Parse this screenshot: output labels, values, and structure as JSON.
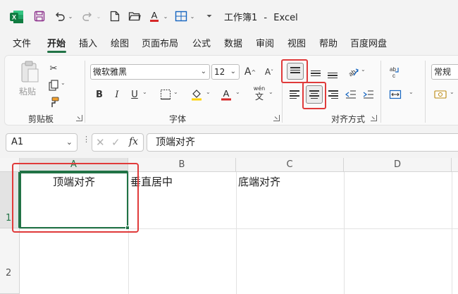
{
  "window": {
    "title": "工作簿1",
    "separator": "-",
    "app": "Excel"
  },
  "menu_tabs": [
    "文件",
    "开始",
    "插入",
    "绘图",
    "页面布局",
    "公式",
    "数据",
    "审阅",
    "视图",
    "帮助",
    "百度网盘"
  ],
  "ribbon": {
    "clipboard": {
      "paste_label": "粘贴",
      "group_label": "剪贴板"
    },
    "font": {
      "family": "微软雅黑",
      "size": "12",
      "group_label": "字体",
      "bold": "B",
      "italic": "I",
      "underline": "U",
      "wen": "wén",
      "wen_char": "文"
    },
    "alignment": {
      "group_label": "对齐方式"
    },
    "number": {
      "format": "常规"
    }
  },
  "formula_bar": {
    "name_box": "A1",
    "fx": "fx",
    "content": "顶端对齐"
  },
  "sheet": {
    "columns": [
      "A",
      "B",
      "C",
      "D"
    ],
    "rows": [
      "1",
      "2"
    ],
    "cells": {
      "A1": "顶端对齐",
      "B1": "垂直居中",
      "C1": "底端对齐"
    }
  },
  "colors": {
    "accent": "#217346",
    "highlight": "#e03a3a"
  }
}
